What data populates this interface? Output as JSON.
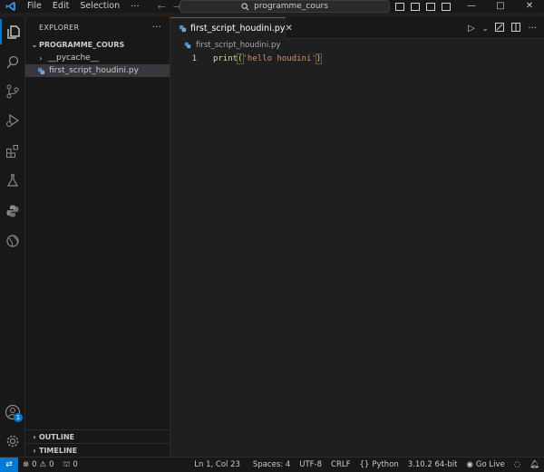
{
  "titlebar": {
    "menus": [
      "File",
      "Edit",
      "Selection"
    ],
    "more": "···",
    "command_center": "programme_cours"
  },
  "window_controls": {
    "minimize": "—",
    "maximize": "□",
    "close": "✕"
  },
  "sidebar": {
    "title": "EXPLORER",
    "more": "···",
    "folder": "PROGRAMME_COURS",
    "items": [
      {
        "label": "__pycache__",
        "type": "folder",
        "expanded": false
      },
      {
        "label": "first_script_houdini.py",
        "type": "python-file",
        "selected": true
      }
    ],
    "outline": "OUTLINE",
    "timeline": "TIMELINE"
  },
  "editor": {
    "tab_label": "first_script_houdini.py",
    "breadcrumb": "first_script_houdini.py",
    "lines": [
      {
        "number": "1",
        "fn": "print",
        "open": "(",
        "string": "'hello houdini'",
        "close": ")"
      }
    ]
  },
  "activity": {
    "account_badge": "1"
  },
  "statusbar": {
    "errors": "0",
    "warnings": "0",
    "ports": "0",
    "position": "Ln 1, Col 23",
    "indent": "Spaces: 4",
    "encoding": "UTF-8",
    "eol": "CRLF",
    "language": "Python",
    "interpreter": "3.10.2 64-bit",
    "golive": "Go Live"
  },
  "colors": {
    "accent": "#0078d4",
    "background": "#1f1f1f",
    "chrome": "#181818"
  }
}
